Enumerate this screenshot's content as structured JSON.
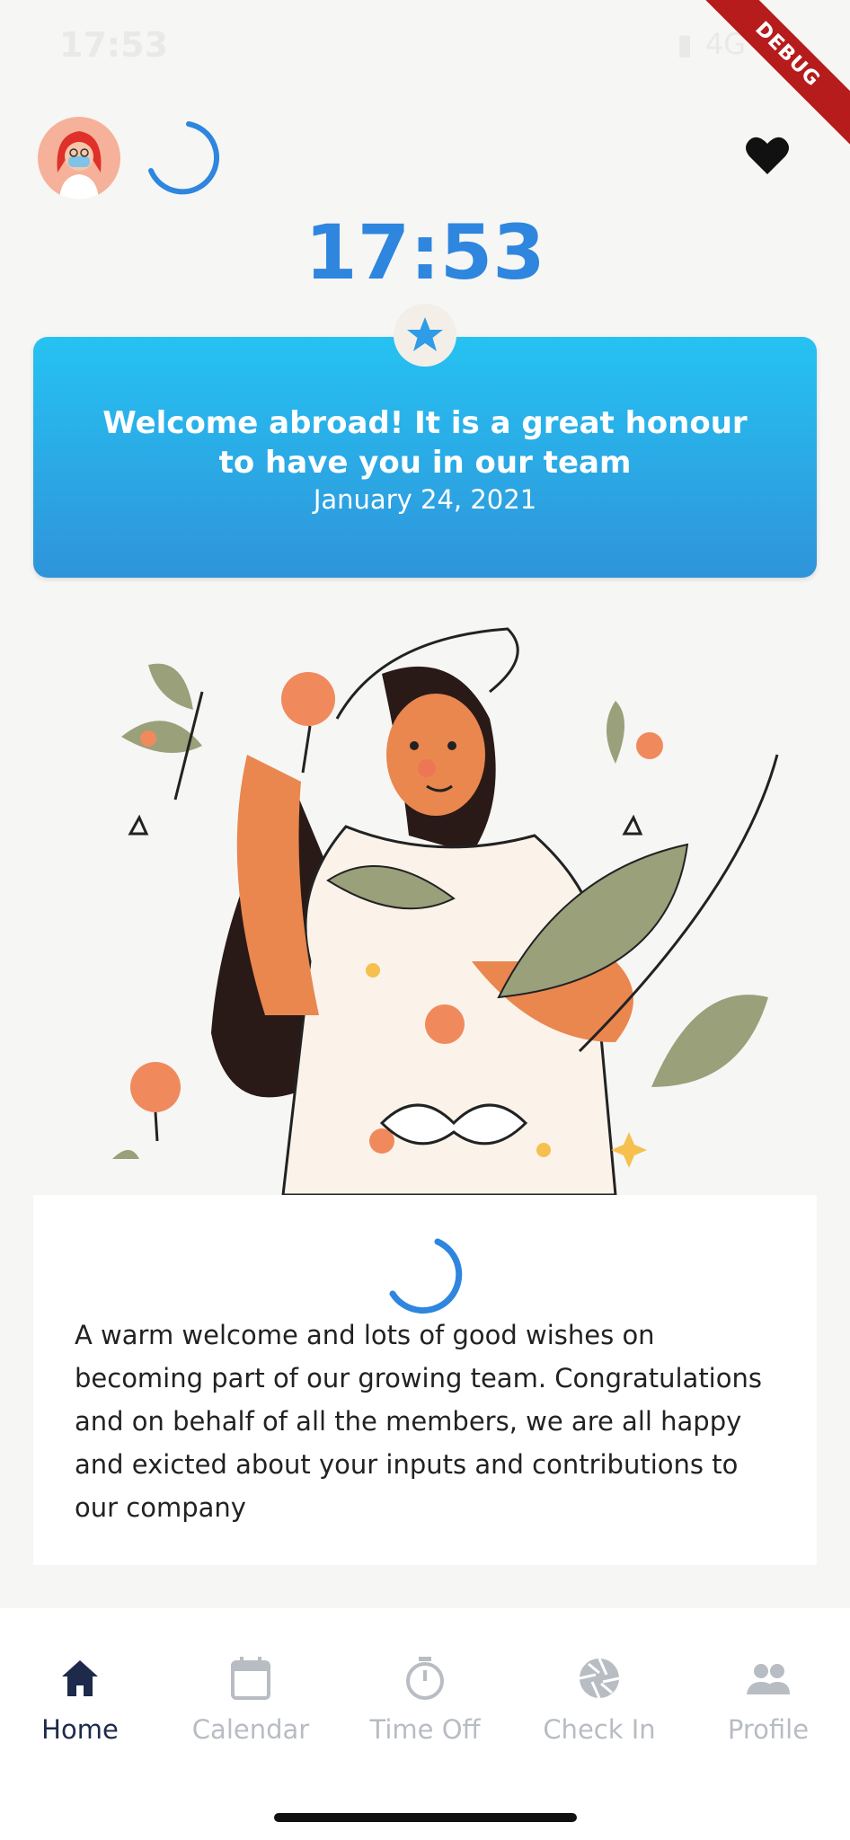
{
  "status": {
    "time": "17:53",
    "network": "4G",
    "debug_label": "DEBUG"
  },
  "header": {
    "clock": "17:53"
  },
  "welcome": {
    "title": "Welcome abroad! It is a great honour to have you in our team",
    "date": "January 24, 2021"
  },
  "message": {
    "text": "A warm welcome and lots of good wishes on becoming part of our growing team. Congratulations and on behalf of all the members, we are all happy and exicted about your inputs and contributions to our company"
  },
  "nav": {
    "items": [
      {
        "label": "Home",
        "icon": "home-icon",
        "active": true
      },
      {
        "label": "Calendar",
        "icon": "calendar-icon",
        "active": false
      },
      {
        "label": "Time Off",
        "icon": "timer-icon",
        "active": false
      },
      {
        "label": "Check In",
        "icon": "shutter-icon",
        "active": false
      },
      {
        "label": "Profile",
        "icon": "people-icon",
        "active": false
      }
    ]
  },
  "colors": {
    "accent": "#2e86de",
    "card_gradient_top": "#26c2f2",
    "card_gradient_bottom": "#2f94da",
    "nav_active": "#1d2a4c",
    "nav_inactive": "#b8bcc3"
  }
}
